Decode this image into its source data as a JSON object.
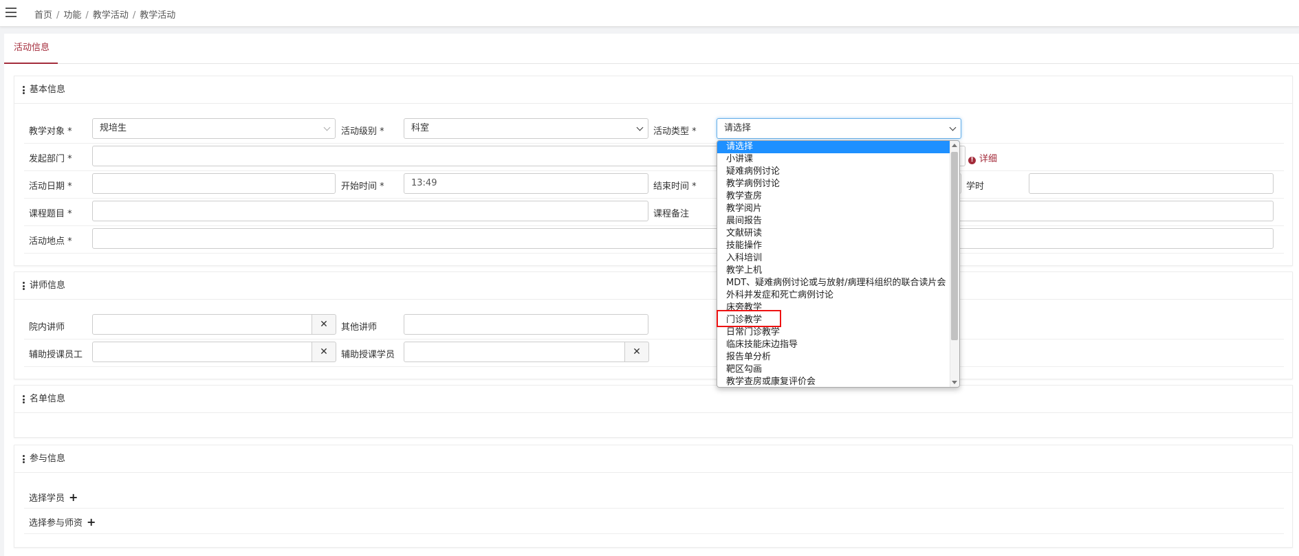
{
  "breadcrumb": [
    "首页",
    "功能",
    "教学活动",
    "教学活动"
  ],
  "tab": "活动信息",
  "sections": {
    "basic": "基本信息",
    "teacher": "讲师信息",
    "list": "名单信息",
    "participate": "参与信息"
  },
  "basic": {
    "object_label": "教学对象 *",
    "object_value": "规培生",
    "level_label": "活动级别 *",
    "level_value": "科室",
    "type_label": "活动类型 *",
    "type_value": "请选择",
    "dept_label": "发起部门 *",
    "detail_link": "详细",
    "date_label": "活动日期 *",
    "start_label": "开始时间 *",
    "start_value": "13:49",
    "end_label": "结束时间 *",
    "hours_label": "学时",
    "topic_label": "课程题目 *",
    "remark_label": "课程备注",
    "place_label": "活动地点 *"
  },
  "teacher": {
    "inner_label": "院内讲师",
    "other_label": "其他讲师",
    "assist_staff_label": "辅助授课员工",
    "assist_student_label": "辅助授课学员"
  },
  "participate": {
    "students_label": "选择学员",
    "teachers_label": "选择参与师资"
  },
  "dropdown_options": [
    "请选择",
    "小讲课",
    "疑难病例讨论",
    "教学病例讨论",
    "教学查房",
    "教学阅片",
    "晨间报告",
    "文献研读",
    "技能操作",
    "入科培训",
    "教学上机",
    "MDT、疑难病例讨论或与放射/病理科组织的联合读片会",
    "外科并发症和死亡病例讨论",
    "床旁教学",
    "门诊教学",
    "日常门诊教学",
    "临床技能床边指导",
    "报告单分析",
    "靶区勾画",
    "教学查房或康复评价会"
  ],
  "colors": {
    "accent": "#a32b3a",
    "selected": "#1e90ff",
    "highlight": "#ee1111"
  }
}
